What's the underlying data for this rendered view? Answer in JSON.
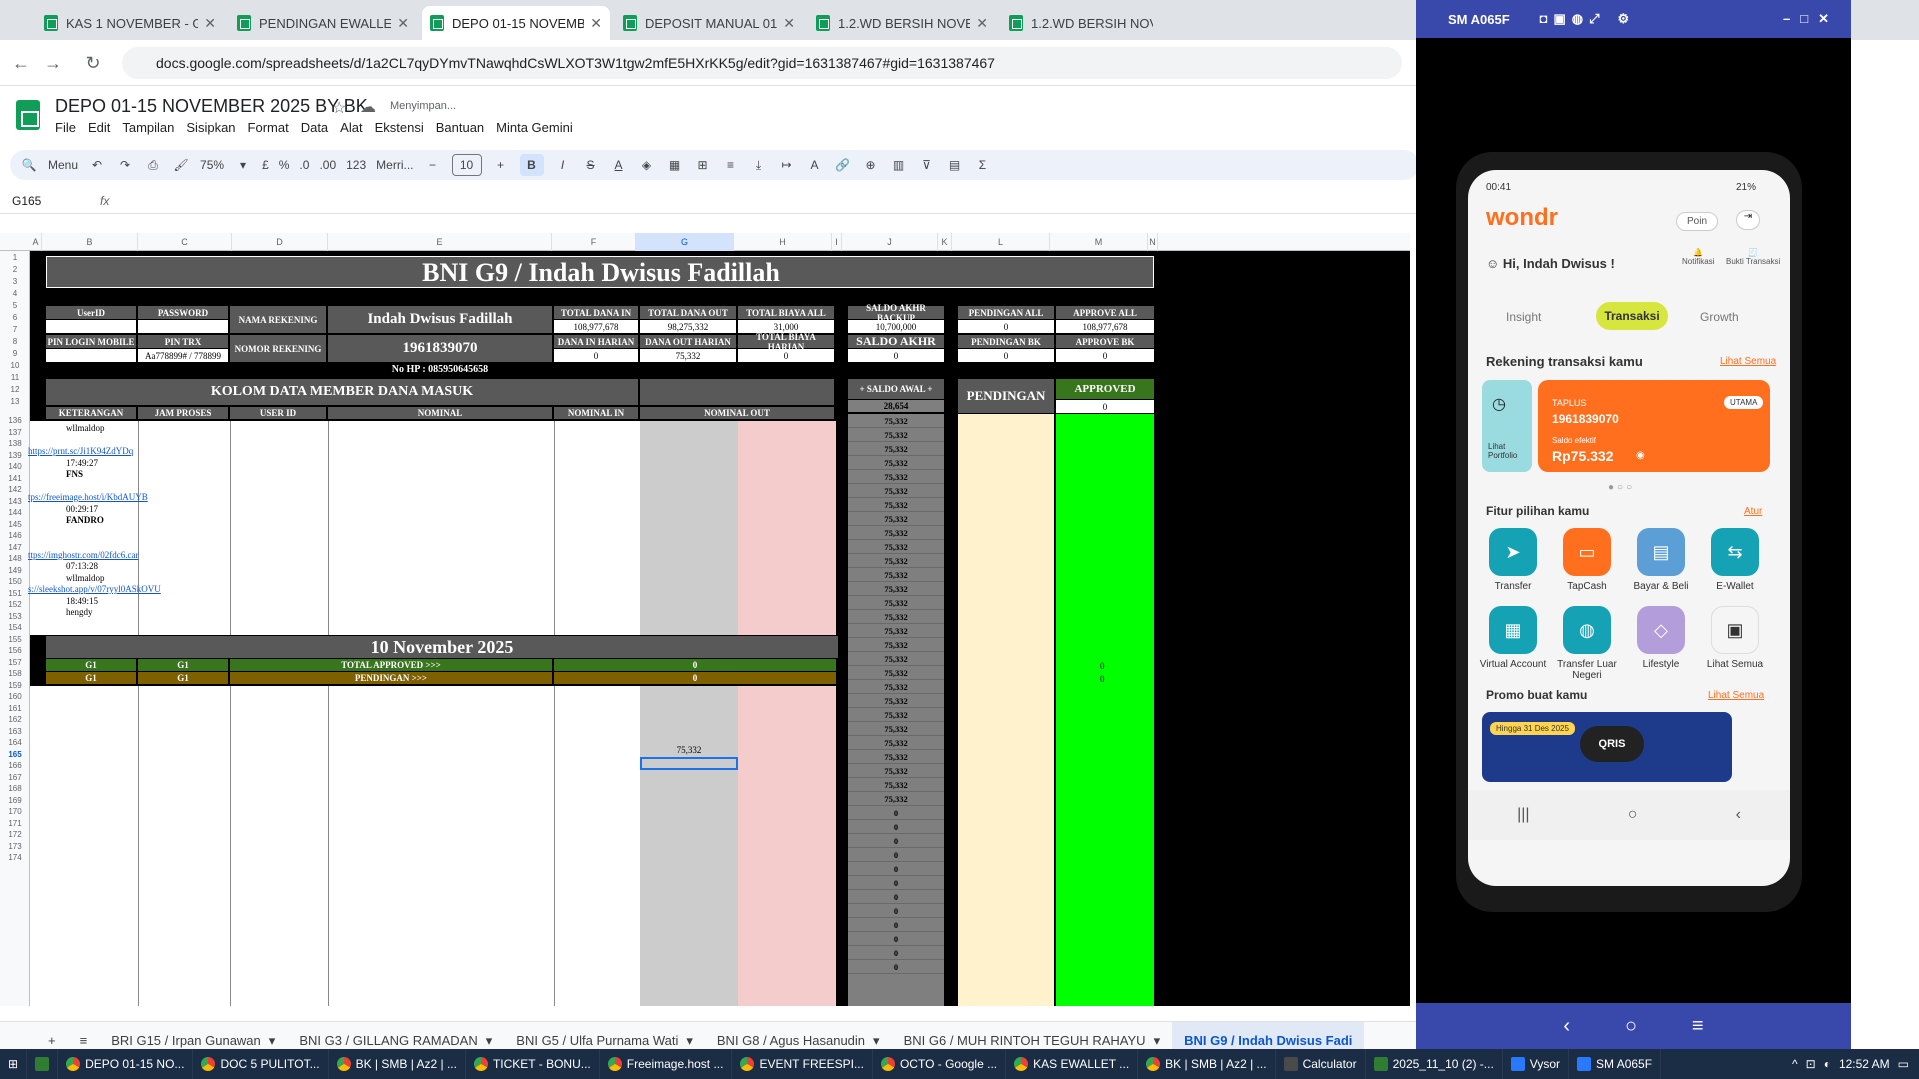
{
  "browser": {
    "tabs": [
      {
        "title": "KAS 1 NOVEMBER - Google Sp",
        "active": false
      },
      {
        "title": "PENDINGAN EWALLET NOVEM",
        "active": false
      },
      {
        "title": "DEPO 01-15 NOVEMBER 2025",
        "active": true
      },
      {
        "title": "DEPOSIT MANUAL 01-30 NOVE",
        "active": false
      },
      {
        "title": "1.2.WD BERSIH NOVEMBER - G",
        "active": false
      },
      {
        "title": "1.2.WD BERSIH NOVEMBER -",
        "active": false
      }
    ],
    "url": "docs.google.com/spreadsheets/d/1a2CL7qyDYmvTNawqhdCsWLXOT3W1tgw2mfE5HXrKK5g/edit?gid=1631387467#gid=1631387467"
  },
  "doc": {
    "title": "DEPO 01-15 NOVEMBER 2025 BY BK",
    "saving": "Menyimpan...",
    "menu": [
      "File",
      "Edit",
      "Tampilan",
      "Sisipkan",
      "Format",
      "Data",
      "Alat",
      "Ekstensi",
      "Bantuan",
      "Minta Gemini"
    ]
  },
  "toolbar": {
    "menu_label": "Menu",
    "zoom": "75%",
    "currency": "£",
    "percent": "%",
    "dec_dec": ".0",
    "dec_inc": ".00",
    "num_format": "123",
    "font": "Merri...",
    "font_size": "10",
    "bold": "B",
    "italic": "I",
    "text_color": "A"
  },
  "formula": {
    "namebox": "G165",
    "fx": "fx"
  },
  "columns": [
    {
      "label": "A",
      "selected": false
    },
    {
      "label": "B",
      "selected": false
    },
    {
      "label": "C",
      "selected": false
    },
    {
      "label": "D",
      "selected": false
    },
    {
      "label": "E",
      "selected": false
    },
    {
      "label": "F",
      "selected": false
    },
    {
      "label": "G",
      "selected": true
    },
    {
      "label": "H",
      "selected": false
    },
    {
      "label": "I",
      "selected": false
    },
    {
      "label": "J",
      "selected": false
    },
    {
      "label": "K",
      "selected": false
    },
    {
      "label": "L",
      "selected": false
    },
    {
      "label": "M",
      "selected": false
    },
    {
      "label": "N",
      "selected": false
    }
  ],
  "rows_top": [
    "1",
    "2",
    "3",
    "4",
    "5",
    "6",
    "7",
    "8",
    "9",
    "10",
    "11",
    "12",
    "13"
  ],
  "rows_body": [
    "136",
    "137",
    "138",
    "139",
    "140",
    "141",
    "142",
    "143",
    "144",
    "145",
    "146",
    "147",
    "148",
    "149",
    "150",
    "151",
    "152",
    "153",
    "154",
    "155",
    "156",
    "157",
    "158",
    "159",
    "160",
    "161",
    "162",
    "163",
    "164",
    "165",
    "166",
    "167",
    "168",
    "169",
    "170",
    "171",
    "172",
    "173",
    "174"
  ],
  "sheet": {
    "banner": "BNI G9 / Indah Dwisus Fadillah",
    "userid_label": "UserID",
    "password_label": "PASSWORD",
    "nama_rekening_label": "NAMA REKENING",
    "nama_rekening": "Indah Dwisus Fadillah",
    "nomor_rekening_label": "NOMOR REKENING",
    "nomor_rekening": "1961839070",
    "pin_login_label": "PIN LOGIN MOBILE",
    "pin_trx_label": "PIN TRX",
    "pin_trx": "Aa778899# / 778899",
    "no_hp": "No HP : 085950645658",
    "total_dana_in_label": "TOTAL DANA IN",
    "total_dana_in": "108,977,678",
    "total_dana_out_label": "TOTAL DANA OUT",
    "total_dana_out": "98,275,332",
    "total_biaya_all_label": "TOTAL BIAYA ALL",
    "total_biaya_all": "31,000",
    "dana_in_harian_label": "DANA IN HARIAN",
    "dana_in_harian": "0",
    "dana_out_harian_label": "DANA OUT HARIAN",
    "dana_out_harian": "75,332",
    "total_biaya_harian_label": "TOTAL BIAYA HARIAN",
    "total_biaya_harian": "0",
    "saldo_akhr_backup_label": "SALDO AKHR BACKUP",
    "saldo_akhr_backup": "10,700,000",
    "saldo_akhr_label": "SALDO AKHR",
    "saldo_akhr": "0",
    "pendingan_all_label": "PENDINGAN ALL",
    "pendingan_all": "0",
    "approve_all_label": "APPROVE ALL",
    "approve_all": "108,977,678",
    "pendingan_bk_label": "PENDINGAN BK",
    "pendingan_bk": "0",
    "approve_bk_label": "APPROVE BK",
    "approve_bk": "0",
    "kolom_title": "KOLOM DATA MEMBER DANA MASUK",
    "saldo_awal_label": "+ SALDO AWAL +",
    "saldo_awal": "28,654",
    "pendingan_label": "PENDINGAN",
    "approved_label": "APPROVED",
    "approved_value": "0",
    "headers": {
      "keterangan": "KETERANGAN",
      "jam_proses": "JAM PROSES",
      "user_id": "USER ID",
      "nominal": "NOMINAL",
      "nominal_in": "NOMINAL IN",
      "nominal_out": "NOMINAL OUT"
    },
    "entries": [
      {
        "text": "wllmaldop",
        "type": "text"
      },
      {
        "text": "",
        "type": "text"
      },
      {
        "text": "https://prnt.sc/Ji1K94ZdYDq",
        "type": "link"
      },
      {
        "text": "17:49:27",
        "type": "text"
      },
      {
        "text": "FNS",
        "type": "bold"
      },
      {
        "text": "",
        "type": "text"
      },
      {
        "text": "tps://freeimage.host/i/KbdAUYB",
        "type": "link"
      },
      {
        "text": "00:29:17",
        "type": "text"
      },
      {
        "text": "FANDRO",
        "type": "bold"
      },
      {
        "text": "",
        "type": "text"
      },
      {
        "text": "",
        "type": "text"
      },
      {
        "text": "ttps://imghostr.com/02fdc6.car",
        "type": "link"
      },
      {
        "text": "07:13:28",
        "type": "text"
      },
      {
        "text": "wllmaldop",
        "type": "text"
      },
      {
        "text": "s://sleekshot.app/v/07ryyl0ASkOVU",
        "type": "link"
      },
      {
        "text": "18:49:15",
        "type": "text"
      },
      {
        "text": "hengdy",
        "type": "text"
      }
    ],
    "date_banner": "10 November 2025",
    "total_row": {
      "g1a": "G1",
      "g1b": "G1",
      "label": "TOTAL APPROVED >>>",
      "value": "0",
      "right_value": "0"
    },
    "pending_row": {
      "g1a": "G1",
      "g1b": "G1",
      "label": "PENDINGAN >>>",
      "value": "0",
      "right_value": "0"
    },
    "nominal_out_cell": "75,332",
    "saldo_values": [
      "75,332",
      "75,332",
      "75,332",
      "75,332",
      "75,332",
      "75,332",
      "75,332",
      "75,332",
      "75,332",
      "75,332",
      "75,332",
      "75,332",
      "75,332",
      "75,332",
      "75,332",
      "75,332",
      "75,332",
      "75,332",
      "75,332",
      "75,332",
      "75,332",
      "75,332",
      "75,332",
      "75,332",
      "75,332",
      "75,332",
      "75,332",
      "75,332",
      "0",
      "0",
      "0",
      "0",
      "0",
      "0",
      "0",
      "0",
      "0",
      "0",
      "0",
      "0"
    ]
  },
  "sheet_tabs": [
    {
      "label": "BRI G15 / Irpan Gunawan",
      "active": false
    },
    {
      "label": "BNI G3 / GILLANG RAMADAN",
      "active": false
    },
    {
      "label": "BNI G5 / Ulfa Purnama Wati",
      "active": false
    },
    {
      "label": "BNI G8 / Agus Hasanudin",
      "active": false
    },
    {
      "label": "BNI G6 / MUH RINTOH TEGUH RAHAYU",
      "active": false
    },
    {
      "label": "BNI G9 / Indah Dwisus Fadi",
      "active": true
    }
  ],
  "vysor": {
    "title": "SM A065F",
    "phone": {
      "status_time": "00:41",
      "status_battery": "21%",
      "brand": "wondr",
      "poin": "Poin",
      "greeting": "Hi, Indah Dwisus !",
      "notif": "Notifikasi",
      "bukti": "Bukti Transaksi",
      "tabs": [
        "Insight",
        "Transaksi",
        "Growth"
      ],
      "rekening_title": "Rekening transaksi kamu",
      "lihat_semua": "Lihat Semua",
      "lihat_portfolio": "Lihat Portfolio",
      "account_type": "TAPLUS",
      "account_badge": "UTAMA",
      "account_number": "1961839070",
      "saldo_label": "Saldo efektif",
      "saldo_value": "Rp75.332",
      "fitur_title": "Fitur pilihan kamu",
      "atur": "Atur",
      "features": [
        "Transfer",
        "TapCash",
        "Bayar & Beli",
        "E-Wallet",
        "Virtual Account",
        "Transfer Luar Negeri",
        "Lifestyle",
        "Lihat Semua"
      ],
      "promo_title": "Promo buat kamu",
      "promo_lihat": "Lihat Semua",
      "promo_text": "Hingga 31 Des 2025",
      "qris": "QRIS"
    }
  },
  "taskbar": {
    "items": [
      {
        "label": "DEPO 01-15 NO...",
        "icon": "chrome"
      },
      {
        "label": "DOC 5 PULITOT...",
        "icon": "chrome"
      },
      {
        "label": "BK | SMB | Az2 | ...",
        "icon": "chrome"
      },
      {
        "label": "TICKET - BONU...",
        "icon": "chrome"
      },
      {
        "label": "Freeimage.host ...",
        "icon": "chrome"
      },
      {
        "label": "EVENT FREESPI...",
        "icon": "chrome"
      },
      {
        "label": "OCTO - Google ...",
        "icon": "chrome"
      },
      {
        "label": "KAS EWALLET ...",
        "icon": "chrome"
      },
      {
        "label": "BK | SMB | Az2 | ...",
        "icon": "chrome"
      },
      {
        "label": "Calculator",
        "icon": "calc"
      },
      {
        "label": "2025_11_10 (2) -...",
        "icon": "excel"
      },
      {
        "label": "Vysor",
        "icon": "vysor"
      },
      {
        "label": "SM A065F",
        "icon": "vysor"
      }
    ],
    "clock": "12:52 AM"
  },
  "colors": {
    "sheet_header_gray": "#595959",
    "saldo_gray": "#7f7f7f",
    "pending_cream": "#fff2cc",
    "approved_green": "#00ff00",
    "nominal_out_pink": "#f4cccc",
    "nominal_gray": "#cccccc",
    "total_approved_green": "#38761d",
    "pending_brown": "#7f6000",
    "vysor_blue": "#3949ab",
    "wondr_orange": "#ff6f1e"
  }
}
